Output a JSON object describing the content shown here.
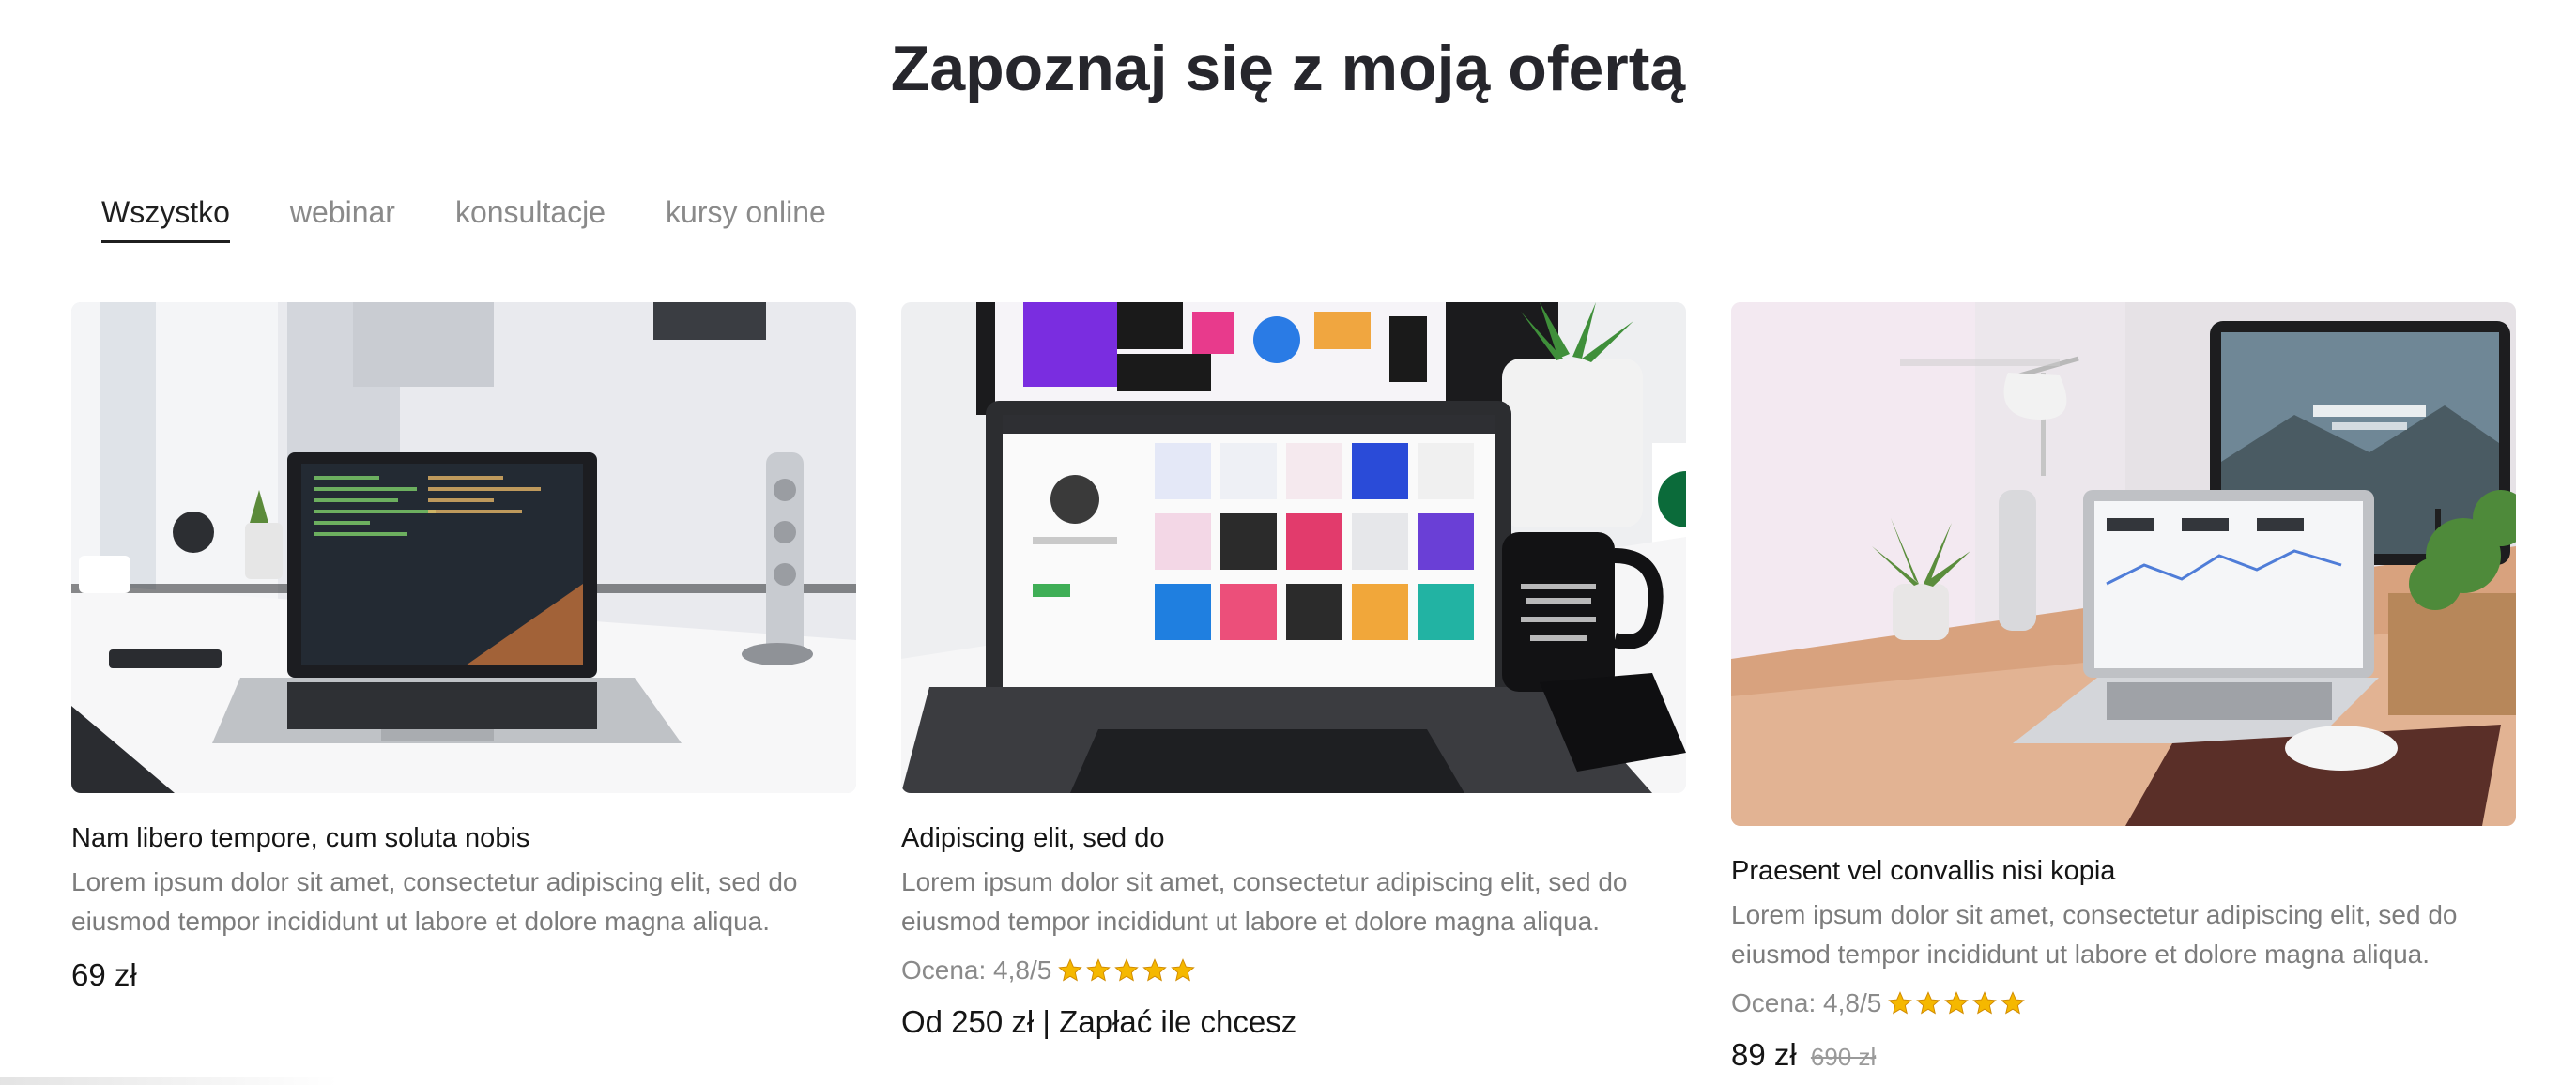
{
  "heading": "Zapoznaj się z moją ofertą",
  "tabs": [
    {
      "label": "Wszystko",
      "active": true
    },
    {
      "label": "webinar",
      "active": false
    },
    {
      "label": "konsultacje",
      "active": false
    },
    {
      "label": "kursy online",
      "active": false
    }
  ],
  "cards": [
    {
      "title": "Nam libero tempore, cum soluta nobis",
      "description": "Lorem ipsum dolor sit amet, consectetur adipiscing elit, sed do eiusmod tempor incididunt ut labore et dolore magna aliqua.",
      "price": "69 zł"
    },
    {
      "title": "Adipiscing elit, sed do",
      "description": "Lorem ipsum dolor sit amet, consectetur adipiscing elit, sed do eiusmod tempor incididunt ut labore et dolore magna aliqua.",
      "rating_text": "Ocena: 4,8/5",
      "rating_stars": 5,
      "price": "Od 250 zł | Zapłać ile chcesz"
    },
    {
      "title": "Praesent vel convallis nisi kopia",
      "description": "Lorem ipsum dolor sit amet, consectetur adipiscing elit, sed do eiusmod tempor incididunt ut labore et dolore magna aliqua.",
      "rating_text": "Ocena: 4,8/5",
      "rating_stars": 5,
      "price": "89 zł",
      "old_price": "690 zł"
    }
  ],
  "colors": {
    "heading": "#26262c",
    "tab_inactive": "#8a8a8a",
    "text_muted": "#7c7c7c",
    "star": "#f5b800"
  }
}
